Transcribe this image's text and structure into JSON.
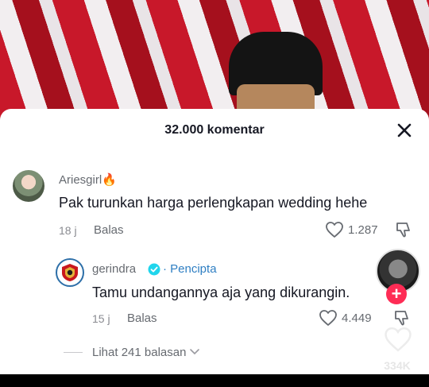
{
  "sheet": {
    "title": "32.000 komentar"
  },
  "comments": [
    {
      "username": "Ariesgirl🔥",
      "text": "Pak turunkan harga perlengkapan wedding hehe",
      "time": "18 j",
      "reply_label": "Balas",
      "likes": "1.287"
    },
    {
      "username": "gerindra",
      "verified": true,
      "creator_label": "· Pencipta",
      "text": "Tamu undangannya aja yang dikurangin.",
      "time": "15 j",
      "reply_label": "Balas",
      "likes": "4.449"
    }
  ],
  "view_replies": {
    "label": "Lihat 241 balasan"
  },
  "overlay": {
    "count": "334K"
  },
  "colors": {
    "accent_red": "#fe2c55",
    "creator_blue": "#2f7fc3",
    "verified_blue": "#20d5ec"
  },
  "icons": [
    "close-icon",
    "heart-icon",
    "dislike-icon",
    "verified-icon",
    "chevron-down-icon",
    "plus-icon"
  ]
}
